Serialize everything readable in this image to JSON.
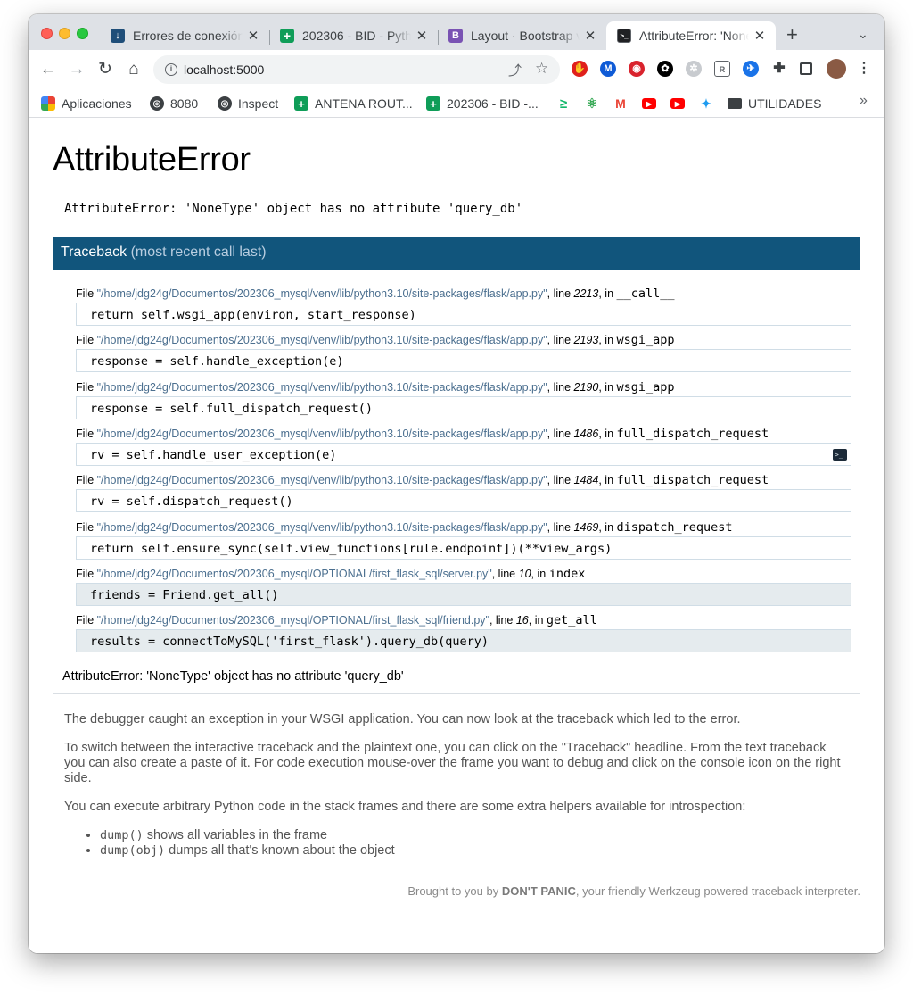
{
  "browser": {
    "tabs": [
      {
        "title": "Errores de conexión",
        "favicon_color": "#1f4e79",
        "favicon_glyph": "↓"
      },
      {
        "title": "202306 - BID - Pyth",
        "favicon_color": "#0f9d58",
        "favicon_glyph": "+"
      },
      {
        "title": "Layout · Bootstrap v",
        "favicon_color": "#7952b3",
        "favicon_glyph": "B"
      },
      {
        "title": "AttributeError: 'None",
        "favicon_color": "#202124",
        "favicon_glyph": ">_"
      }
    ],
    "close_glyph": "✕",
    "new_tab_glyph": "+",
    "tab_menu_glyph": "⌄",
    "address": {
      "url": "localhost:5000"
    },
    "bookmarks": [
      {
        "label": "Aplicaciones",
        "icon": "apps-grid-icon"
      },
      {
        "label": "8080",
        "icon": "globe-icon"
      },
      {
        "label": "Inspect",
        "icon": "globe-icon"
      },
      {
        "label": "ANTENA ROUT...",
        "icon": "sheets-icon"
      },
      {
        "label": "202306 - BID -...",
        "icon": "sheets-icon"
      },
      {
        "label": "",
        "icon": "terminal-prompt-icon"
      },
      {
        "label": "",
        "icon": "react-icon"
      },
      {
        "label": "",
        "icon": "gmail-icon"
      },
      {
        "label": "",
        "icon": "youtube-icon"
      },
      {
        "label": "",
        "icon": "youtube-icon"
      },
      {
        "label": "",
        "icon": "twitter-icon"
      },
      {
        "label": "UTILIDADES",
        "icon": "folder-icon"
      }
    ]
  },
  "error": {
    "title": "AttributeError",
    "message": "AttributeError: 'NoneType' object has no attribute 'query_db'"
  },
  "traceback": {
    "header": "Traceback",
    "header_sub": "(most recent call last)",
    "file_prefix": "File ",
    "line_prefix": ", line ",
    "in_prefix": ", in ",
    "frames": [
      {
        "path": "\"/home/jdg24g/Documentos/202306_mysql/venv/lib/python3.10/site-packages/flask/app.py\"",
        "line": "2213",
        "func": "__call__",
        "code": "return self.wsgi_app(environ, start_response)"
      },
      {
        "path": "\"/home/jdg24g/Documentos/202306_mysql/venv/lib/python3.10/site-packages/flask/app.py\"",
        "line": "2193",
        "func": "wsgi_app",
        "code": "response = self.handle_exception(e)"
      },
      {
        "path": "\"/home/jdg24g/Documentos/202306_mysql/venv/lib/python3.10/site-packages/flask/app.py\"",
        "line": "2190",
        "func": "wsgi_app",
        "code": "response = self.full_dispatch_request()"
      },
      {
        "path": "\"/home/jdg24g/Documentos/202306_mysql/venv/lib/python3.10/site-packages/flask/app.py\"",
        "line": "1486",
        "func": "full_dispatch_request",
        "code": "rv = self.handle_user_exception(e)"
      },
      {
        "path": "\"/home/jdg24g/Documentos/202306_mysql/venv/lib/python3.10/site-packages/flask/app.py\"",
        "line": "1484",
        "func": "full_dispatch_request",
        "code": "rv = self.dispatch_request()"
      },
      {
        "path": "\"/home/jdg24g/Documentos/202306_mysql/venv/lib/python3.10/site-packages/flask/app.py\"",
        "line": "1469",
        "func": "dispatch_request",
        "code": "return self.ensure_sync(self.view_functions[rule.endpoint])(**view_args)"
      },
      {
        "path": "\"/home/jdg24g/Documentos/202306_mysql/OPTIONAL/first_flask_sql/server.py\"",
        "line": "10",
        "func": "index",
        "code": "friends = Friend.get_all()"
      },
      {
        "path": "\"/home/jdg24g/Documentos/202306_mysql/OPTIONAL/first_flask_sql/friend.py\"",
        "line": "16",
        "func": "get_all",
        "code": "results = connectToMySQL('first_flask').query_db(query)"
      }
    ],
    "final": "AttributeError: 'NoneType' object has no attribute 'query_db'"
  },
  "explanation": {
    "p1": "The debugger caught an exception in your WSGI application. You can now look at the traceback which led to the error.",
    "p2": "To switch between the interactive traceback and the plaintext one, you can click on the \"Traceback\" headline. From the text traceback you can also create a paste of it. For code execution mouse-over the frame you want to debug and click on the console icon on the right side.",
    "p3": "You can execute arbitrary Python code in the stack frames and there are some extra helpers available for introspection:",
    "helpers": [
      {
        "code": "dump()",
        "text": " shows all variables in the frame"
      },
      {
        "code": "dump(obj)",
        "text": " dumps all that's known about the object"
      }
    ]
  },
  "footer": {
    "before": "Brought to you by ",
    "brand": "DON'T PANIC",
    "after": ", your friendly Werkzeug powered traceback interpreter."
  },
  "colors": {
    "traceback_header": "#11557c",
    "app_frame_bg": "#e5ebee",
    "tabstrip": "#dee1e6"
  }
}
